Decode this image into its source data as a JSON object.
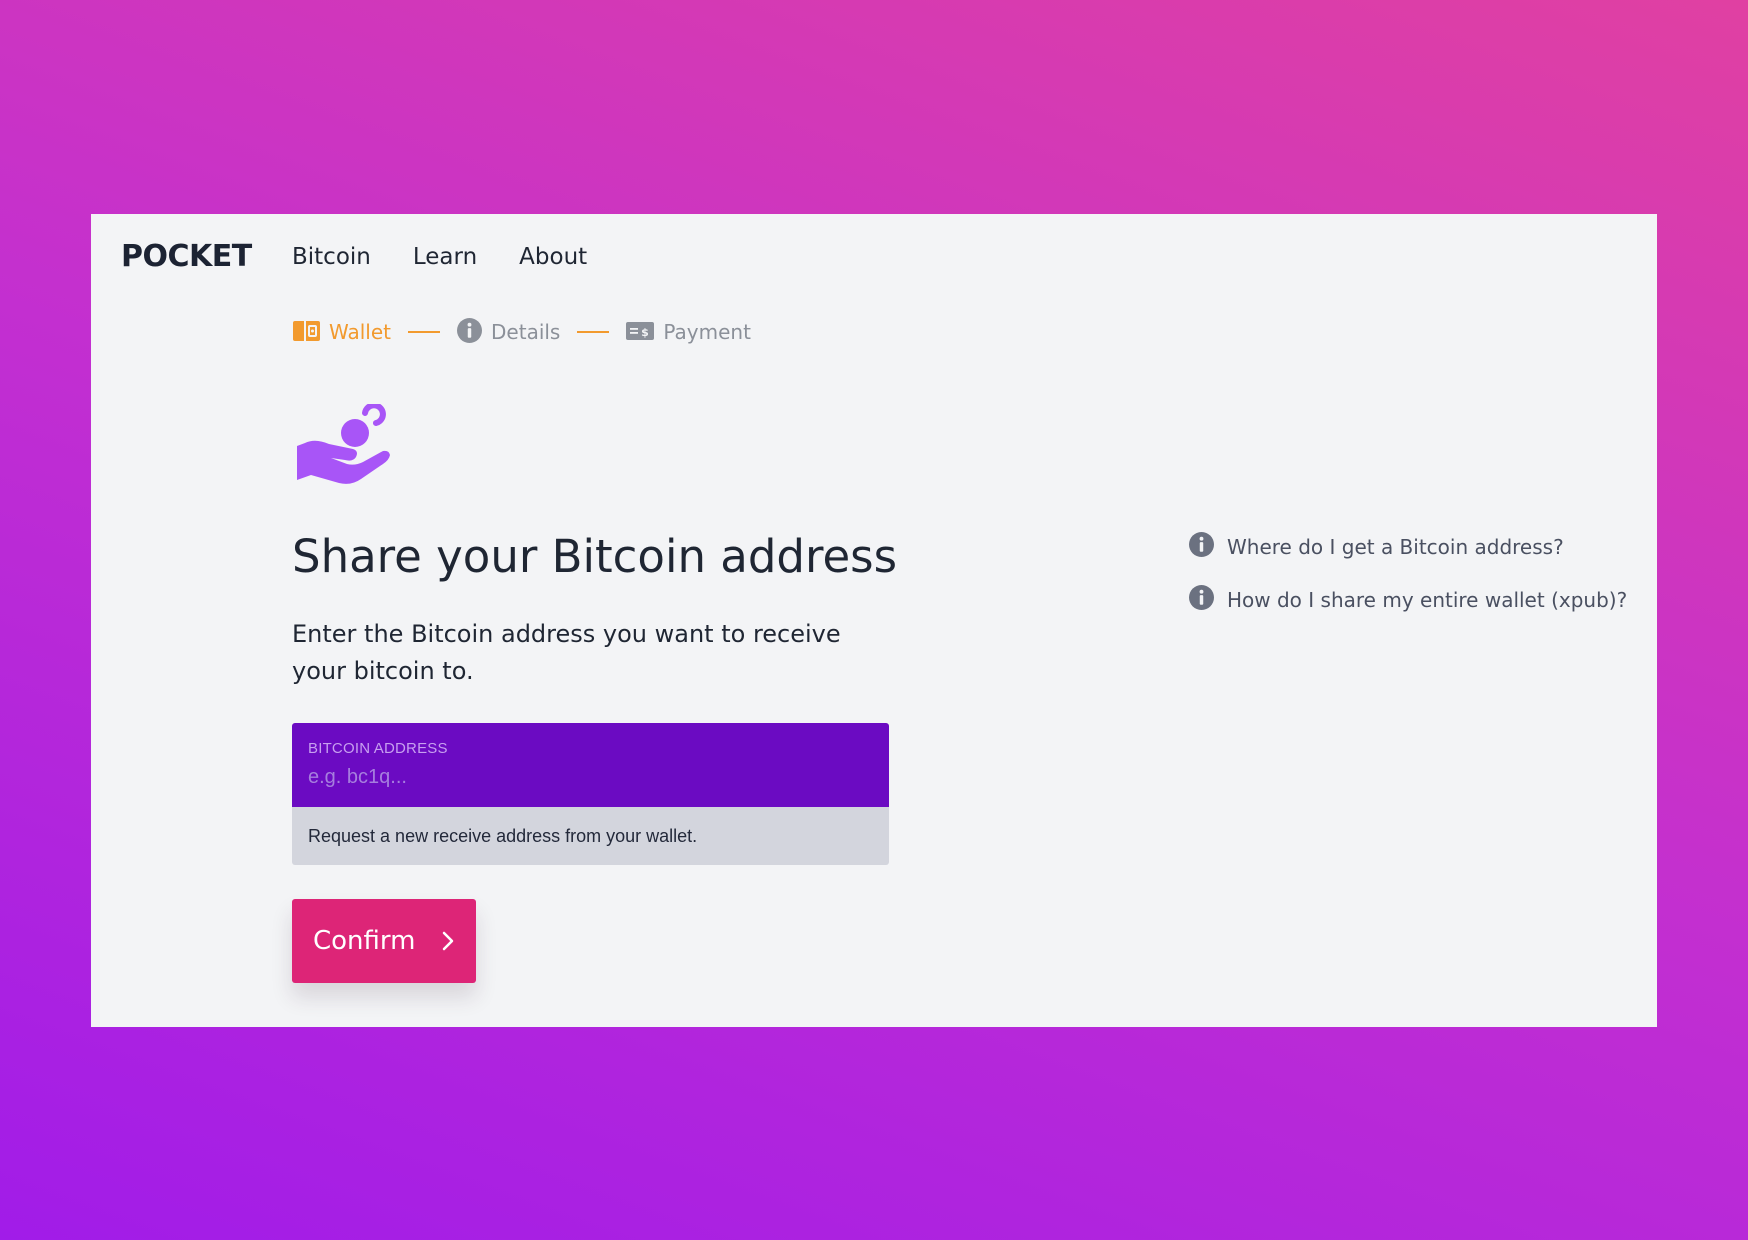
{
  "brand": {
    "logo_text": "POCKET"
  },
  "nav": {
    "items": [
      "Bitcoin",
      "Learn",
      "About"
    ]
  },
  "steps": [
    {
      "label": "Wallet",
      "icon": "wallet-icon",
      "state": "active"
    },
    {
      "label": "Details",
      "icon": "info-icon",
      "state": "inactive"
    },
    {
      "label": "Payment",
      "icon": "payment-icon",
      "state": "inactive"
    }
  ],
  "main": {
    "icon": "hand-coin-icon",
    "title": "Share your Bitcoin address",
    "description": "Enter the Bitcoin address you want to receive your bitcoin to.",
    "field": {
      "label": "BITCOIN ADDRESS",
      "placeholder": "e.g. bc1q...",
      "value": ""
    },
    "hint": "Request a new receive address from your wallet.",
    "confirm_label": "Confirm"
  },
  "help": {
    "items": [
      "Where do I get a Bitcoin address?",
      "How do I share my entire wallet (xpub)?"
    ]
  },
  "colors": {
    "accent_orange": "#f29a2e",
    "field_purple": "#6b0bc2",
    "button_pink": "#dd2577",
    "icon_purple": "#a855f7",
    "text_dark": "#1f2633"
  }
}
